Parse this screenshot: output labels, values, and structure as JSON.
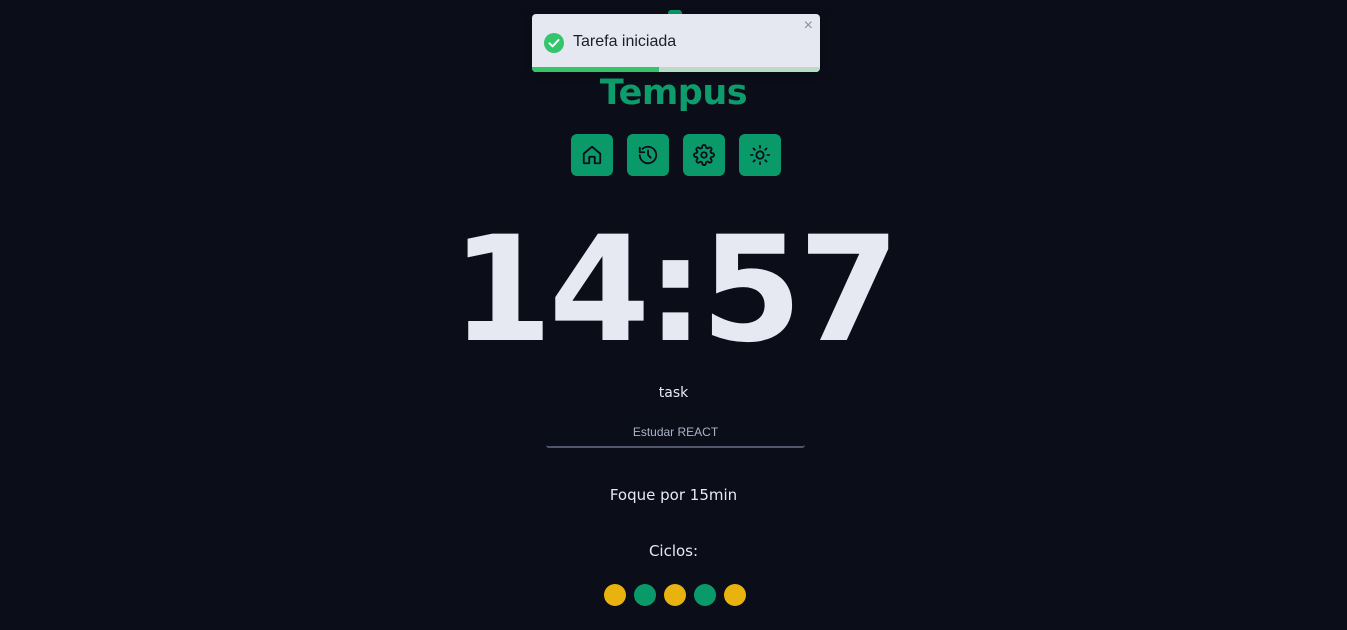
{
  "app": {
    "title": "Tempus"
  },
  "nav": {
    "items": [
      {
        "name": "home",
        "icon": "home-icon"
      },
      {
        "name": "history",
        "icon": "history-icon"
      },
      {
        "name": "settings",
        "icon": "gear-icon"
      },
      {
        "name": "theme",
        "icon": "sun-icon"
      }
    ]
  },
  "timer": {
    "display": "14:57"
  },
  "task": {
    "label": "task",
    "value": "Estudar REACT"
  },
  "focus": {
    "text": "Foque por 15min"
  },
  "cycles": {
    "label": "Ciclos:",
    "items": [
      {
        "type": "work",
        "color": "#e8b20f"
      },
      {
        "type": "short-break",
        "color": "#0a9a6a"
      },
      {
        "type": "work",
        "color": "#e8b20f"
      },
      {
        "type": "short-break",
        "color": "#0a9a6a"
      },
      {
        "type": "work",
        "color": "#e8b20f"
      }
    ]
  },
  "toast": {
    "message": "Tarefa iniciada",
    "close_label": "×",
    "progress": 0.44,
    "icon": "check-circle-icon"
  },
  "colors": {
    "background": "#0b0e18",
    "accent": "#0a9a6a",
    "text": "#e6e9f2",
    "warning": "#e8b20f",
    "success": "#34c46c"
  }
}
